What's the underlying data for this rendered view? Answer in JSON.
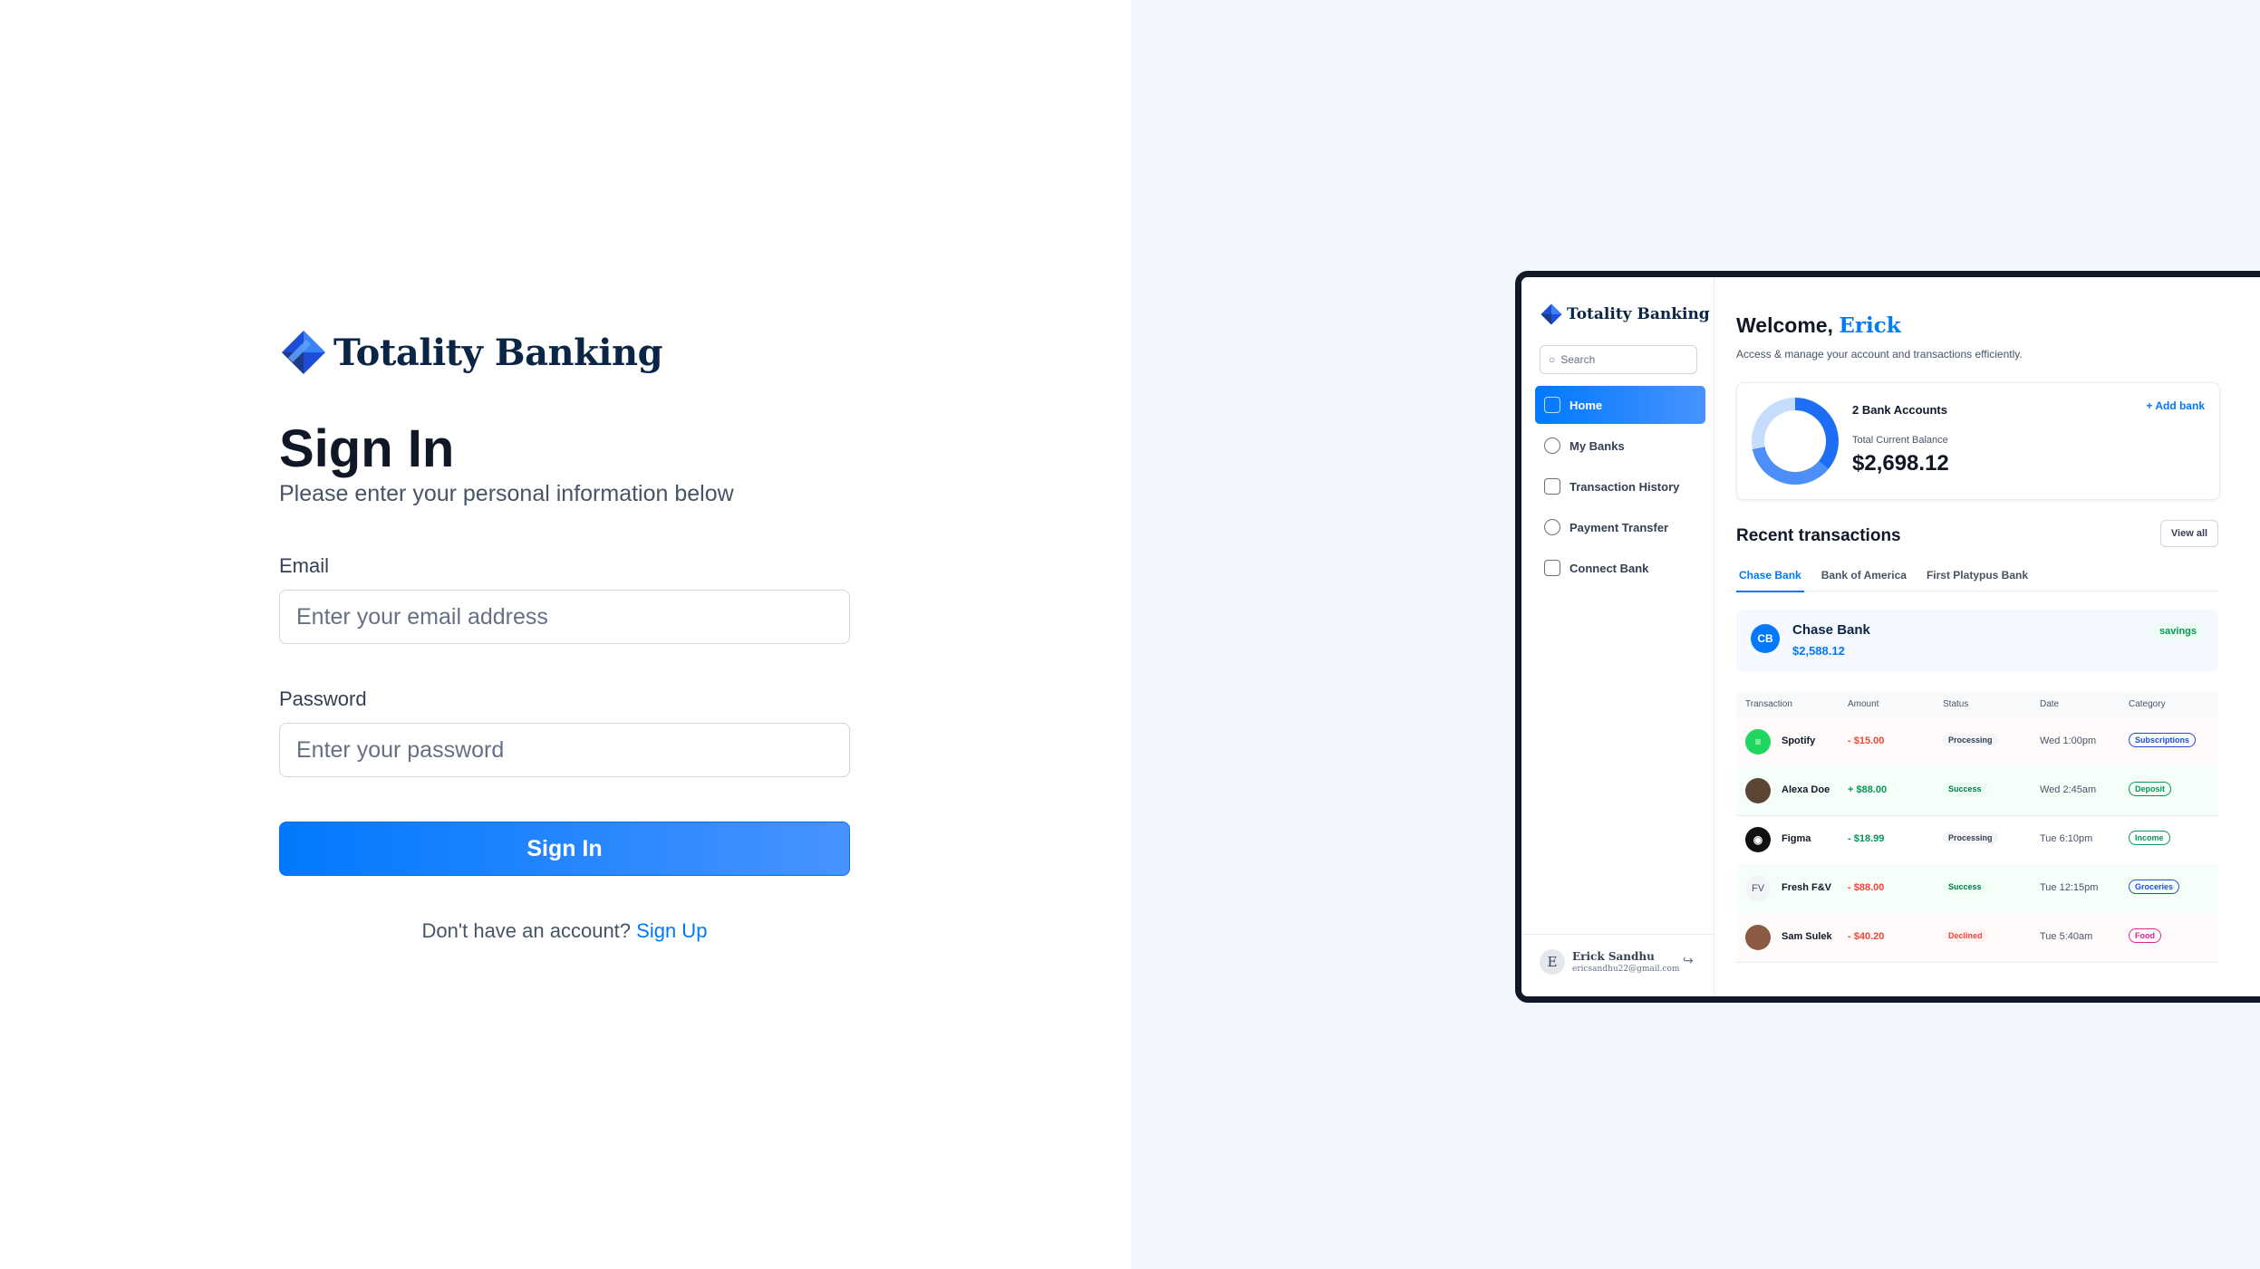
{
  "brand": {
    "name": "Totality Banking"
  },
  "signin": {
    "title": "Sign In",
    "subtitle": "Please enter your personal information below",
    "email_label": "Email",
    "email_placeholder": "Enter your email address",
    "email_value": "",
    "password_label": "Password",
    "password_placeholder": "Enter your password",
    "password_value": "",
    "submit_label": "Sign In",
    "footer_text": "Don't have an account?",
    "footer_link": "Sign Up"
  },
  "preview": {
    "search_placeholder": "Search",
    "nav": [
      {
        "label": "Home",
        "active": true
      },
      {
        "label": "My Banks",
        "active": false
      },
      {
        "label": "Transaction History",
        "active": false
      },
      {
        "label": "Payment Transfer",
        "active": false
      },
      {
        "label": "Connect Bank",
        "active": false
      }
    ],
    "user": {
      "initial": "E",
      "name": "Erick Sandhu",
      "email": "ericsandhu22@gmail.com"
    },
    "welcome_prefix": "Welcome,",
    "welcome_name": "Erick",
    "welcome_sub": "Access & manage your account and transactions efficiently.",
    "balance_card": {
      "accounts": "2 Bank Accounts",
      "add_bank": "+ Add bank",
      "label": "Total Current Balance",
      "amount": "$2,698.12"
    },
    "recent_title": "Recent transactions",
    "view_all": "View all",
    "tabs": [
      "Chase Bank",
      "Bank of America",
      "First Platypus Bank"
    ],
    "bank": {
      "initials": "CB",
      "name": "Chase Bank",
      "amount": "$2,588.12",
      "type": "savings"
    },
    "table_headers": [
      "Transaction",
      "Amount",
      "Status",
      "Date",
      "Category"
    ],
    "transactions": [
      {
        "name": "Spotify",
        "amount": "- $15.00",
        "status": "Processing",
        "date": "Wed 1:00pm",
        "category": "Subscriptions"
      },
      {
        "name": "Alexa Doe",
        "amount": "+ $88.00",
        "status": "Success",
        "date": "Wed 2:45am",
        "category": "Deposit"
      },
      {
        "name": "Figma",
        "amount": "- $18.99",
        "status": "Processing",
        "date": "Tue 6:10pm",
        "category": "Income"
      },
      {
        "name": "Fresh F&V",
        "amount": "- $88.00",
        "status": "Success",
        "date": "Tue 12:15pm",
        "category": "Groceries"
      },
      {
        "name": "Sam Sulek",
        "amount": "- $40.20",
        "status": "Declined",
        "date": "Tue 5:40am",
        "category": "Food"
      }
    ],
    "row_initials": {
      "fresh": "FV"
    }
  },
  "colors": {
    "accent": "#0179fe",
    "brand_navy": "#0b2545",
    "right_panel_bg": "#f2f6fd"
  }
}
